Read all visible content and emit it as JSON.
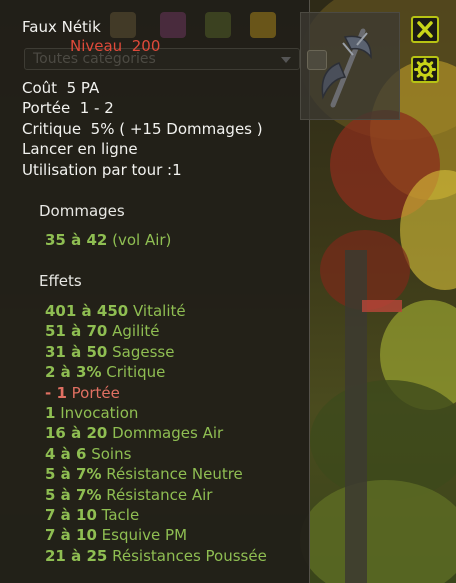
{
  "item": {
    "name": "Faux Nétik",
    "level_label": "Niveau",
    "level_value": "200"
  },
  "category_select": {
    "value": "Toutes catégories"
  },
  "stats": [
    {
      "label": "Coût",
      "value": "5 PA"
    },
    {
      "label": "Portée",
      "value": "1 - 2"
    },
    {
      "label": "Critique",
      "value": "5% ( +15 Dommages )"
    },
    {
      "label": "Lancer en ligne",
      "value": ""
    },
    {
      "label": "Utilisation par tour :",
      "value": "1"
    }
  ],
  "dommages": {
    "title": "Dommages",
    "line_value": "35 à 42",
    "line_label": "(vol Air)"
  },
  "effets": {
    "title": "Effets",
    "lines": [
      {
        "value": "401 à 450",
        "label": "Vitalité",
        "kind": "positive"
      },
      {
        "value": "51 à 70",
        "label": "Agilité",
        "kind": "positive"
      },
      {
        "value": "31 à 50",
        "label": "Sagesse",
        "kind": "positive"
      },
      {
        "value": "2 à 3%",
        "label": "Critique",
        "kind": "positive"
      },
      {
        "value": "- 1",
        "label": "Portée",
        "kind": "negative"
      },
      {
        "value": "1",
        "label": "Invocation",
        "kind": "positive"
      },
      {
        "value": "16 à 20",
        "label": "Dommages Air",
        "kind": "positive"
      },
      {
        "value": "4 à 6",
        "label": "Soins",
        "kind": "positive"
      },
      {
        "value": "5 à 7%",
        "label": "Résistance Neutre",
        "kind": "positive"
      },
      {
        "value": "5 à 7%",
        "label": "Résistance Air",
        "kind": "positive"
      },
      {
        "value": "7 à 10",
        "label": "Tacle",
        "kind": "positive"
      },
      {
        "value": "7 à 10",
        "label": "Esquive PM",
        "kind": "positive"
      },
      {
        "value": "21 à 25",
        "label": "Résistances Poussée",
        "kind": "positive"
      }
    ]
  },
  "icons": {
    "close": "close-icon",
    "settings": "gear-icon",
    "item": "scythe-icon"
  },
  "colors": {
    "level": "#e04a3a",
    "positive_effect": "#8fbe52",
    "negative_effect": "#e07062",
    "button_border": "#b7c313",
    "button_icon": "#c8d418"
  }
}
